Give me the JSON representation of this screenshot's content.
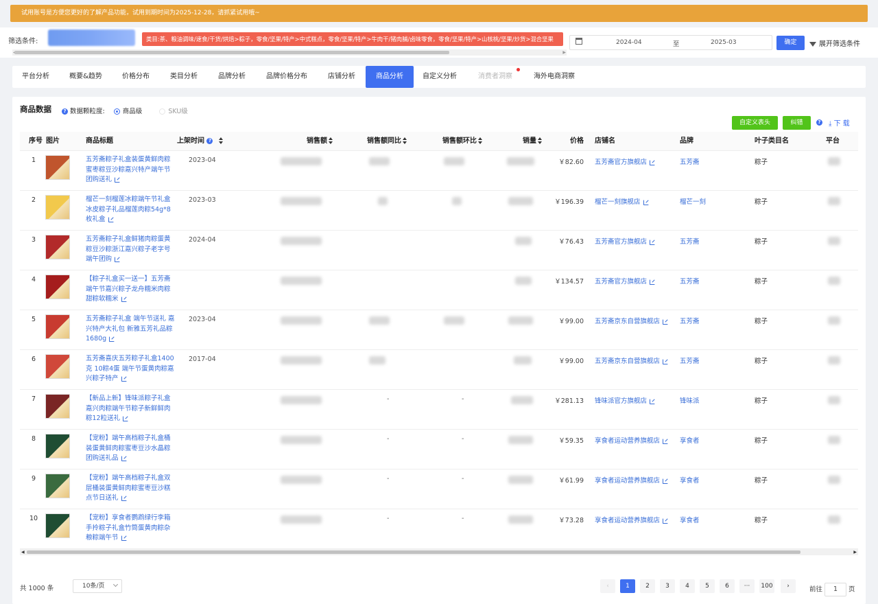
{
  "notice": "试用账号是方便您更好的了解产品功能，试用到期时间为2025-12-28，请抓紧试用哦~",
  "filter": {
    "label": "筛选条件:",
    "tag": "类目:茶、粮油调味/速食/干货/烘焙>粽子，零食/坚果/特产>中式糕点，零食/坚果/特产>牛肉干/猪肉脯/卤味零食，零食/坚果/特产>山核桃/坚果/炒货>混合坚果",
    "date_start": "2024-04",
    "date_sep": "至",
    "date_end": "2025-03",
    "confirm": "确定",
    "expand": "展开筛选条件"
  },
  "tabs": [
    {
      "label": "平台分析",
      "state": "normal"
    },
    {
      "label": "概要&趋势",
      "state": "normal"
    },
    {
      "label": "价格分布",
      "state": "normal"
    },
    {
      "label": "类目分析",
      "state": "normal"
    },
    {
      "label": "品牌分析",
      "state": "normal"
    },
    {
      "label": "品牌价格分布",
      "state": "normal"
    },
    {
      "label": "店铺分析",
      "state": "normal"
    },
    {
      "label": "商品分析",
      "state": "active"
    },
    {
      "label": "自定义分析",
      "state": "normal"
    },
    {
      "label": "消费者洞察",
      "state": "disabled"
    },
    {
      "label": "海外电商洞察",
      "state": "normal"
    }
  ],
  "card": {
    "title": "商品数据",
    "granularity_label": "数据颗粒度:",
    "option_product": "商品级",
    "option_sku": "SKU级",
    "btn_custom": "自定义表头",
    "btn_fix": "纠错",
    "download": "下 载"
  },
  "columns": {
    "idx": "序号",
    "img": "图片",
    "title": "商品标题",
    "date": "上架时间",
    "sales": "销售额",
    "yoy": "销售额同比",
    "mom": "销售额环比",
    "volume": "销量",
    "price": "价格",
    "shop": "店铺名",
    "brand": "品牌",
    "cat": "叶子类目名",
    "platform": "平台"
  },
  "rows": [
    {
      "idx": "1",
      "title": "五芳斋粽子礼盒装蛋黄鲜肉粽蜜枣粽豆沙粽嘉兴特产端午节团购送礼",
      "date": "2023-04",
      "yoy": "",
      "mom": "",
      "price": "￥82.60",
      "shop": "五芳斋官方旗舰店",
      "brand": "五芳斋",
      "cat": "粽子",
      "img_color": "#c0552d"
    },
    {
      "idx": "2",
      "title": "榴芒一刻榴莲冰粽端午节礼盒冰皮粽子礼品榴莲肉粽54g*8枚礼盒",
      "date": "2023-03",
      "yoy": "",
      "mom": "",
      "price": "￥196.39",
      "shop": "榴芒一刻旗舰店",
      "brand": "榴芒一刻",
      "cat": "粽子",
      "img_color": "#f2c94c"
    },
    {
      "idx": "3",
      "title": "五芳斋粽子礼盒鲜猪肉粽蛋黄粽豆沙粽浙江嘉兴粽子老字号端午团购",
      "date": "2024-04",
      "yoy": "",
      "mom": "",
      "price": "￥76.43",
      "shop": "五芳斋官方旗舰店",
      "brand": "五芳斋",
      "cat": "粽子",
      "img_color": "#b22a2a"
    },
    {
      "idx": "4",
      "title": "【粽子礼盒买一送一】五芳斋端午节嘉兴粽子龙舟糯米肉粽甜粽软糯米",
      "date": "",
      "yoy": "",
      "mom": "",
      "price": "￥134.57",
      "shop": "五芳斋官方旗舰店",
      "brand": "五芳斋",
      "cat": "粽子",
      "img_color": "#a51d1d"
    },
    {
      "idx": "5",
      "title": "五芳斋粽子礼盒 端午节送礼 嘉兴特产大礼包 新雅五芳礼品粽1680g",
      "date": "2023-04",
      "yoy": "",
      "mom": "",
      "price": "￥99.00",
      "shop": "五芳斋京东自营旗舰店",
      "brand": "五芳斋",
      "cat": "粽子",
      "img_color": "#c83b30"
    },
    {
      "idx": "6",
      "title": "五芳斋喜庆五芳粽子礼盒1400克 10粽4蛋 端午节蛋黄肉粽嘉兴粽子特产",
      "date": "2017-04",
      "yoy": "",
      "mom": "",
      "price": "￥99.00",
      "shop": "五芳斋京东自营旗舰店",
      "brand": "五芳斋",
      "cat": "粽子",
      "img_color": "#d0483a"
    },
    {
      "idx": "7",
      "title": "【新品上新】锋味派粽子礼盒嘉兴肉粽端午节粽子新鲜鲜肉粽12粒送礼",
      "date": "",
      "yoy": "-",
      "mom": "-",
      "price": "￥281.13",
      "shop": "锋味派官方旗舰店",
      "brand": "锋味派",
      "cat": "粽子",
      "img_color": "#7a2525"
    },
    {
      "idx": "8",
      "title": "【宠粉】端午高档粽子礼盒桶装蛋黄鲜肉粽蜜枣豆沙水晶粽团购送礼品",
      "date": "",
      "yoy": "-",
      "mom": "-",
      "price": "￥59.35",
      "shop": "享食者运动营养旗舰店",
      "brand": "享食者",
      "cat": "粽子",
      "img_color": "#1f4d33"
    },
    {
      "idx": "9",
      "title": "【宠粉】端午高档粽子礼盒双层桶装蛋黄鲜肉粽蜜枣豆沙糕点节日送礼",
      "date": "",
      "yoy": "-",
      "mom": "-",
      "price": "￥61.99",
      "shop": "享食者运动营养旗舰店",
      "brand": "享食者",
      "cat": "粽子",
      "img_color": "#3a6b3f"
    },
    {
      "idx": "10",
      "title": "【宠粉】享食者鹦鹉绿行李箱手拎粽子礼盒竹筒蛋黄肉粽杂粮粽端午节",
      "date": "",
      "yoy": "-",
      "mom": "-",
      "price": "￥73.28",
      "shop": "享食者运动营养旗舰店",
      "brand": "享食者",
      "cat": "粽子",
      "img_color": "#1f4d33"
    }
  ],
  "footer": {
    "total": "共 1000 条",
    "page_size": "10条/页",
    "pages": [
      "1",
      "2",
      "3",
      "4",
      "5",
      "6",
      "···",
      "100"
    ],
    "goto_prefix": "前往",
    "goto_value": "1",
    "goto_suffix": "页"
  }
}
